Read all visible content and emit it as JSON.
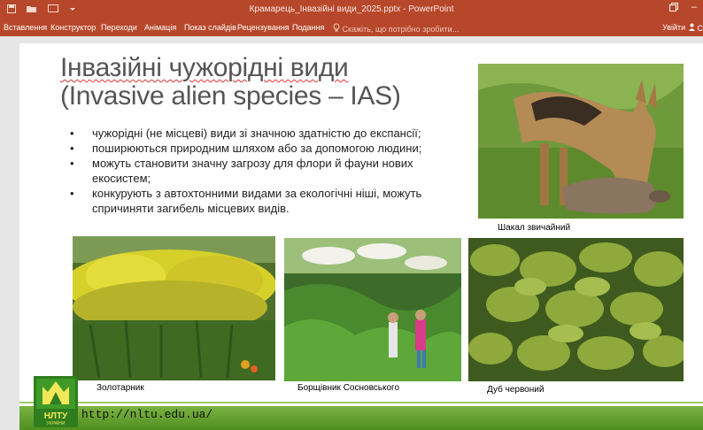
{
  "window": {
    "title": "Крамарець_Інвазійні види_2025.pptx - PowerPoint",
    "restore_icon": "restore-icon",
    "minimize_glyph": "–"
  },
  "ribbon": {
    "tabs": [
      "Вставлення",
      "Конструктор",
      "Переходи",
      "Анімація",
      "Показ слайдів",
      "Рецензування",
      "Подання"
    ],
    "search_placeholder": "Скажіть, що потрібно зробити...",
    "sign_in": "Увійти",
    "share_glyph": "Сп"
  },
  "slide": {
    "title_line1": "Інвазійні чужорідні види",
    "title_line2": "(Invasive alien species – IAS)",
    "bullets": [
      "чужорідні (не місцеві) види зі значною здатністю до експансії;",
      "поширюються природним шляхом або за допомогою людини;",
      "можуть становити значну загрозу для флори й фауни нових екосистем;",
      "конкурують з автохтонними видами за екологічні ніші, можуть спричиняти загибель місцевих видів."
    ],
    "captions": {
      "jackal": "Шакал звичайний",
      "goldenrod": "Золотарник",
      "hogweed": "Борщівник Сосновського",
      "oak": "Дуб червоний"
    },
    "logo_text": "НЛТУ",
    "logo_subtext": "УКРАЇНИ",
    "url": "http://nltu.edu.ua/"
  },
  "colors": {
    "ribbon": "#b7472a",
    "footer_green": "#5e9e2a",
    "title_gray": "#555555"
  }
}
